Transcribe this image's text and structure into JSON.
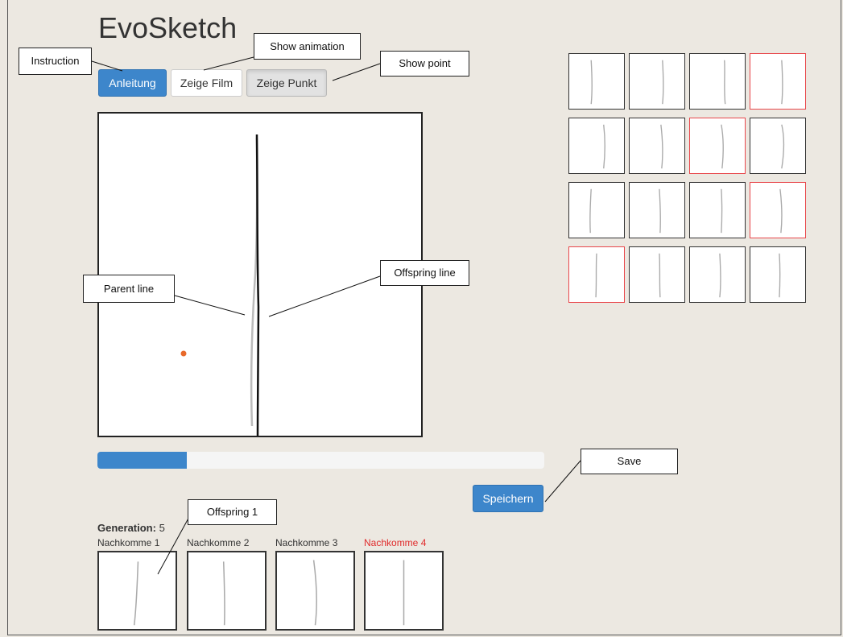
{
  "app": {
    "title": "EvoSketch"
  },
  "toolbar": {
    "instruction_label": "Anleitung",
    "film_label": "Zeige Film",
    "point_label": "Zeige Punkt"
  },
  "annotations": {
    "instruction": "Instruction",
    "show_animation": "Show animation",
    "show_point": "Show point",
    "parent_line": "Parent line",
    "offspring_line": "Offspring line",
    "save": "Save",
    "offspring_1": "Offspring 1"
  },
  "progress": {
    "fraction": 0.2
  },
  "save_button": {
    "label": "Speichern"
  },
  "generation": {
    "label": "Generation:",
    "value": "5"
  },
  "offspring": [
    {
      "label": "Nachkomme 1",
      "highlighted": false
    },
    {
      "label": "Nachkomme 2",
      "highlighted": false
    },
    {
      "label": "Nachkomme 3",
      "highlighted": false
    },
    {
      "label": "Nachkomme 4",
      "highlighted": true
    }
  ],
  "history_grid": {
    "selected": [
      3,
      6,
      11,
      12
    ]
  },
  "colors": {
    "primary": "#3d86cb",
    "background": "#ece8e1",
    "selected_border": "#e8474b",
    "point": "#e8692a",
    "highlight_label": "#e02b2b"
  }
}
